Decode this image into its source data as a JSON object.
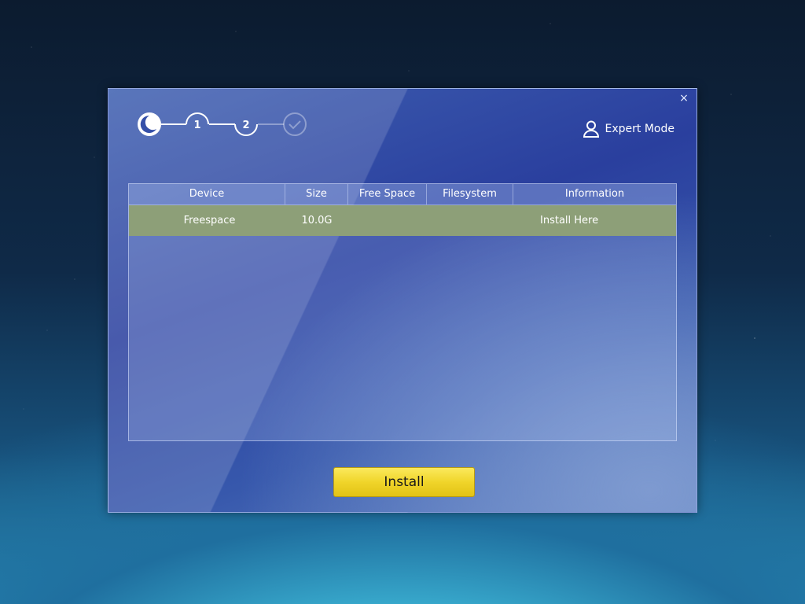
{
  "dialog": {
    "close_label": "×",
    "steps": {
      "step1": "1",
      "step2": "2"
    },
    "expert_mode_label": "Expert Mode"
  },
  "table": {
    "columns": [
      "Device",
      "Size",
      "Free Space",
      "Filesystem",
      "Information"
    ],
    "rows": [
      {
        "device": "Freespace",
        "size": "10.0G",
        "free_space": "",
        "filesystem": "",
        "information": "Install Here"
      }
    ]
  },
  "install_label": "Install",
  "colors": {
    "selected_row": "#8d9f78",
    "install_button": "#f0d52a",
    "dialog_bg": "#2a3f9e"
  }
}
